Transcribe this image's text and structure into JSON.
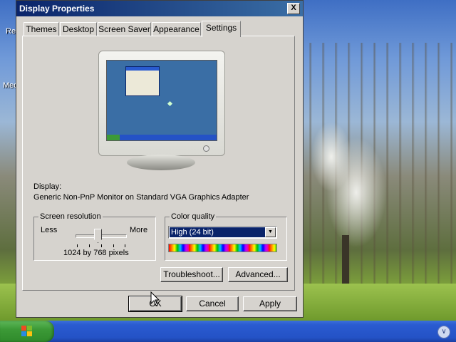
{
  "desktop": {
    "label_1": "Re",
    "label_2": "Med"
  },
  "taskbar": {
    "tray_icon": "chevron-icon"
  },
  "dialog": {
    "title": "Display Properties",
    "close_label": "X",
    "tabs": [
      {
        "label": "Themes"
      },
      {
        "label": "Desktop"
      },
      {
        "label": "Screen Saver"
      },
      {
        "label": "Appearance"
      },
      {
        "label": "Settings",
        "active": true
      }
    ],
    "display_label": "Display:",
    "display_value": "Generic Non-PnP Monitor on Standard VGA Graphics Adapter",
    "resolution": {
      "group_title": "Screen resolution",
      "less": "Less",
      "more": "More",
      "value_text": "1024 by 768 pixels",
      "slider_position": 0.6
    },
    "color_quality": {
      "group_title": "Color quality",
      "selected": "High (24 bit)"
    },
    "buttons": {
      "troubleshoot": "Troubleshoot...",
      "advanced": "Advanced...",
      "ok": "OK",
      "cancel": "Cancel",
      "apply": "Apply"
    }
  },
  "colors": {
    "title_start": "#0a246a",
    "title_end": "#3a6ea5",
    "dialog_face": "#d6d3ce",
    "selection": "#0a246a"
  }
}
